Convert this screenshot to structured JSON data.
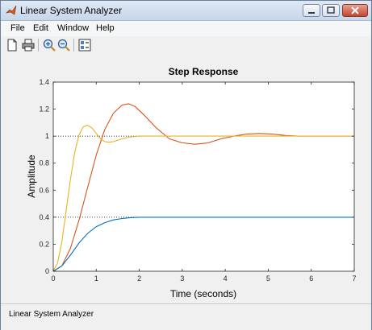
{
  "window": {
    "title": "Linear System Analyzer"
  },
  "menu": [
    {
      "label": "File"
    },
    {
      "label": "Edit"
    },
    {
      "label": "Window"
    },
    {
      "label": "Help"
    }
  ],
  "toolbar": {
    "buttons": [
      {
        "icon": "new-file-icon"
      },
      {
        "icon": "print-icon"
      },
      {
        "icon": "zoom-in-icon"
      },
      {
        "icon": "zoom-out-icon"
      },
      {
        "icon": "plot-configuration-icon"
      }
    ]
  },
  "status": {
    "text": "Linear System Analyzer"
  },
  "chart_data": {
    "type": "line",
    "title": "Step Response",
    "xlabel": "Time (seconds)",
    "ylabel": "Amplitude",
    "xlim": [
      0,
      7
    ],
    "ylim": [
      0,
      1.4
    ],
    "xticks": [
      "0",
      "1",
      "2",
      "3",
      "4",
      "5",
      "6",
      "7"
    ],
    "yticks": [
      "0",
      "0.2",
      "0.4",
      "0.6",
      "0.8",
      "1",
      "1.2",
      "1.4"
    ],
    "grid": false,
    "reference_lines": [
      {
        "y": 1.0,
        "style": "dotted"
      },
      {
        "y": 0.4,
        "style": "dotted"
      }
    ],
    "series": [
      {
        "color": "#d95319",
        "x": [
          0,
          0.2,
          0.4,
          0.6,
          0.8,
          1.0,
          1.2,
          1.4,
          1.6,
          1.75,
          1.9,
          2.1,
          2.4,
          2.7,
          3.0,
          3.3,
          3.6,
          3.9,
          4.2,
          4.5,
          4.8,
          5.1,
          5.4,
          5.7,
          6.0,
          6.5,
          7.0
        ],
        "y": [
          0,
          0.04,
          0.17,
          0.38,
          0.62,
          0.86,
          1.05,
          1.17,
          1.23,
          1.24,
          1.22,
          1.16,
          1.06,
          0.98,
          0.95,
          0.94,
          0.95,
          0.98,
          1.0,
          1.015,
          1.02,
          1.015,
          1.005,
          1.0,
          1.0,
          1.0,
          1.0
        ]
      },
      {
        "color": "#edb120",
        "x": [
          0,
          0.1,
          0.2,
          0.3,
          0.4,
          0.5,
          0.6,
          0.7,
          0.8,
          0.9,
          1.0,
          1.1,
          1.2,
          1.3,
          1.4,
          1.6,
          1.8,
          2.0,
          2.5,
          3.0,
          4.0,
          5.0,
          6.0,
          7.0
        ],
        "y": [
          0,
          0.06,
          0.22,
          0.45,
          0.68,
          0.88,
          1.01,
          1.07,
          1.08,
          1.06,
          1.02,
          0.98,
          0.96,
          0.955,
          0.96,
          0.98,
          0.995,
          1.0,
          1.0,
          1.0,
          1.0,
          1.0,
          1.0,
          1.0
        ]
      },
      {
        "color": "#0072bd",
        "x": [
          0,
          0.2,
          0.4,
          0.6,
          0.8,
          1.0,
          1.2,
          1.4,
          1.6,
          1.8,
          2.0,
          2.5,
          3.0,
          4.0,
          5.0,
          6.0,
          7.0
        ],
        "y": [
          0,
          0.04,
          0.12,
          0.21,
          0.28,
          0.33,
          0.36,
          0.38,
          0.39,
          0.397,
          0.4,
          0.4,
          0.4,
          0.4,
          0.4,
          0.4,
          0.4
        ]
      }
    ]
  }
}
